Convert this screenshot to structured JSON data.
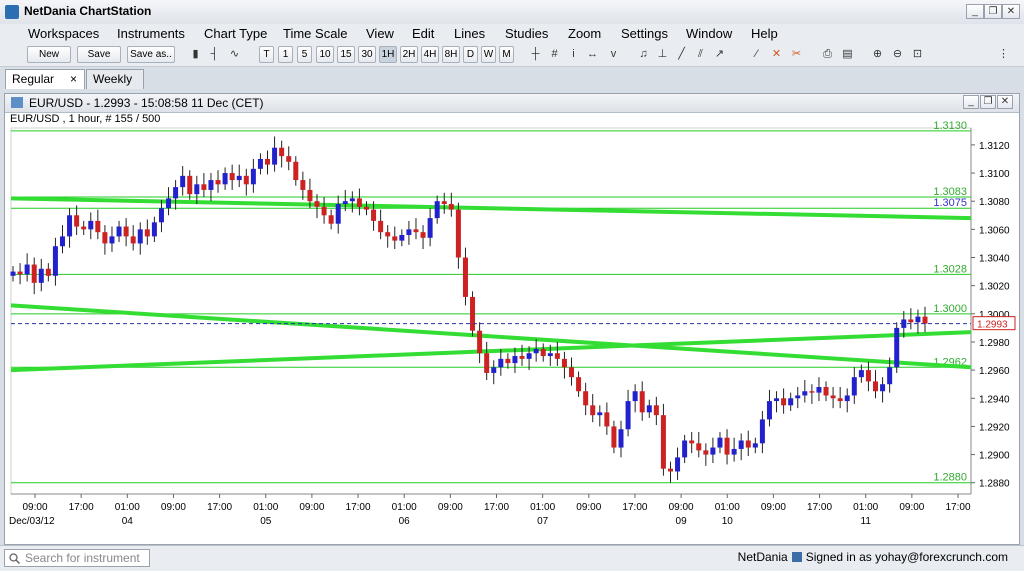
{
  "app": {
    "title": "NetDania ChartStation"
  },
  "menu": [
    "Workspaces",
    "Instruments",
    "Chart Type",
    "Time Scale",
    "View",
    "Edit",
    "Lines",
    "Studies",
    "Zoom",
    "Settings",
    "Window",
    "Help"
  ],
  "toolbar": {
    "new_label": "New",
    "save_label": "Save",
    "save_as_label": "Save as..",
    "timescales": [
      "T",
      "1",
      "5",
      "10",
      "15",
      "30",
      "1H",
      "2H",
      "4H",
      "8H",
      "D",
      "W",
      "M"
    ],
    "selected_timescale": "1H"
  },
  "tabs": [
    {
      "label": "Regular",
      "close": "×"
    },
    {
      "label": "Weekly"
    }
  ],
  "chart_window": {
    "title": "EUR/USD - 1.2993 - 15:08:58  11 Dec (CET)",
    "series_label": "EUR/USD , 1 hour, # 155 / 500"
  },
  "chart_data": {
    "type": "candlestick",
    "instrument": "EUR/USD",
    "interval": "1 hour",
    "last_price": 1.2993,
    "y_range": [
      1.2872,
      1.3132
    ],
    "y_ticks": [
      "1.3120",
      "1.3100",
      "1.3080",
      "1.3060",
      "1.3040",
      "1.3020",
      "1.3000",
      "1.2980",
      "1.2960",
      "1.2940",
      "1.2920",
      "1.2900",
      "1.2880"
    ],
    "y_tick_values": [
      1.312,
      1.31,
      1.308,
      1.306,
      1.304,
      1.302,
      1.3,
      1.298,
      1.296,
      1.294,
      1.292,
      1.29,
      1.288
    ],
    "horizontal_lines": [
      {
        "label": "1.3130",
        "value": 1.313
      },
      {
        "label": "1.3083",
        "value": 1.3083
      },
      {
        "label": "1.3075",
        "value": 1.3075,
        "color": "#3333cc"
      },
      {
        "label": "1.3028",
        "value": 1.3028
      },
      {
        "label": "1.3000",
        "value": 1.3
      },
      {
        "label": "1.2962",
        "value": 1.2962
      },
      {
        "label": "1.2880",
        "value": 1.288
      }
    ],
    "price_line": {
      "label": "1.2993",
      "value": 1.2993
    },
    "trend_lines": [
      {
        "from": [
          0,
          1.3082
        ],
        "to": [
          1,
          1.3068
        ]
      },
      {
        "from": [
          0,
          1.3006
        ],
        "to": [
          1,
          1.2962
        ]
      },
      {
        "from": [
          0,
          1.296
        ],
        "to": [
          1,
          1.2987
        ]
      }
    ],
    "x_tick_labels": [
      "09:00",
      "17:00",
      "01:00",
      "09:00",
      "17:00",
      "01:00",
      "09:00",
      "17:00",
      "01:00",
      "09:00",
      "17:00",
      "01:00",
      "09:00",
      "17:00",
      "09:00",
      "01:00",
      "09:00",
      "17:00",
      "01:00",
      "09:00",
      "17:00"
    ],
    "x_date_labels": [
      {
        "label": "Dec/03/12",
        "index": 0
      },
      {
        "label": "04",
        "index": 2
      },
      {
        "label": "05",
        "index": 5
      },
      {
        "label": "06",
        "index": 8
      },
      {
        "label": "07",
        "index": 11
      },
      {
        "label": "09",
        "index": 14
      },
      {
        "label": "10",
        "index": 15
      },
      {
        "label": "11",
        "index": 18
      }
    ],
    "closes": [
      1.303,
      1.3028,
      1.3035,
      1.3022,
      1.3032,
      1.3027,
      1.3048,
      1.3055,
      1.307,
      1.3062,
      1.306,
      1.3066,
      1.3058,
      1.305,
      1.3055,
      1.3062,
      1.3055,
      1.305,
      1.306,
      1.3055,
      1.3065,
      1.3075,
      1.3082,
      1.309,
      1.3098,
      1.3085,
      1.3092,
      1.3088,
      1.3095,
      1.3092,
      1.31,
      1.3095,
      1.3098,
      1.3092,
      1.3103,
      1.311,
      1.3106,
      1.3118,
      1.3112,
      1.3108,
      1.3095,
      1.3088,
      1.308,
      1.3076,
      1.307,
      1.3064,
      1.3078,
      1.308,
      1.3082,
      1.3076,
      1.3074,
      1.3066,
      1.3058,
      1.3055,
      1.3052,
      1.3056,
      1.306,
      1.3058,
      1.3054,
      1.3068,
      1.308,
      1.3078,
      1.3074,
      1.304,
      1.3012,
      1.2988,
      1.2972,
      1.2958,
      1.2962,
      1.2968,
      1.2965,
      1.297,
      1.2968,
      1.2972,
      1.2975,
      1.297,
      1.2972,
      1.2968,
      1.2962,
      1.2955,
      1.2945,
      1.2935,
      1.2928,
      1.293,
      1.292,
      1.2905,
      1.2918,
      1.2938,
      1.2945,
      1.293,
      1.2935,
      1.2928,
      1.289,
      1.2888,
      1.2898,
      1.291,
      1.2908,
      1.2903,
      1.29,
      1.2905,
      1.2912,
      1.29,
      1.2904,
      1.291,
      1.2905,
      1.2908,
      1.2925,
      1.2938,
      1.294,
      1.2935,
      1.294,
      1.2942,
      1.2945,
      1.2944,
      1.2948,
      1.2942,
      1.294,
      1.2938,
      1.2942,
      1.2955,
      1.296,
      1.2952,
      1.2945,
      1.295,
      1.2962,
      1.299,
      1.2996,
      1.2994,
      1.2998,
      1.2993
    ]
  },
  "status": {
    "search_placeholder": "Search for instrument",
    "brand": "NetDania",
    "signed_in": "Signed in as yohay@forexcrunch.com"
  }
}
